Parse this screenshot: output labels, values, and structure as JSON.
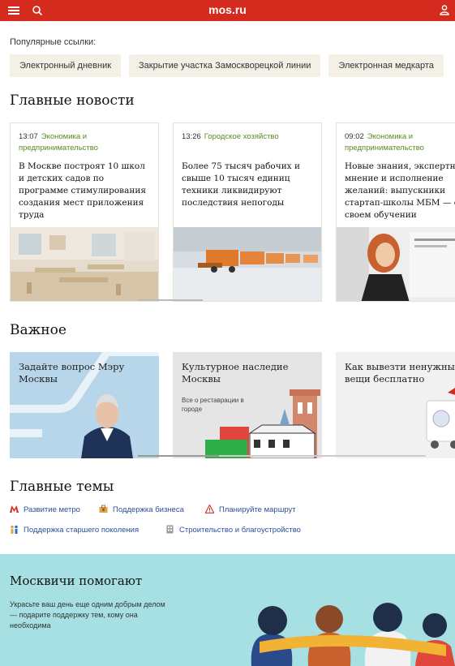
{
  "header": {
    "brand": "mos.ru"
  },
  "popular": {
    "label": "Популярные ссылки:",
    "chips": [
      "Электронный дневник",
      "Закрытие участка Замоскворецкой линии",
      "Электронная медкарта"
    ]
  },
  "news": {
    "heading": "Главные новости",
    "cards": [
      {
        "time": "13:07",
        "category": "Экономика и предпринимательство",
        "title": "В Москве построят 10 школ и детских садов по программе стимулирования создания мест приложения труда"
      },
      {
        "time": "13:26",
        "category": "Городское хозяйство",
        "title": "Более 75 тысяч рабочих и свыше 10 тысяч единиц техники ликвидируют последствия непогоды"
      },
      {
        "time": "09:02",
        "category": "Экономика и предпринимательство",
        "title": "Новые знания, экспертное мнение и исполнение желаний: выпускники стартап-школы МБМ — о своем обучении"
      }
    ]
  },
  "important": {
    "heading": "Важное",
    "tiles": [
      {
        "title": "Задайте вопрос Мэру Москвы",
        "subtitle": ""
      },
      {
        "title": "Культурное наследие Москвы",
        "subtitle": "Все о реставрации в городе"
      },
      {
        "title": "Как вывезти ненужные вещи бесплатно",
        "subtitle": ""
      }
    ]
  },
  "themes": {
    "heading": "Главные темы",
    "items": [
      {
        "label": "Развитие метро",
        "icon": "metro-icon"
      },
      {
        "label": "Поддержка бизнеса",
        "icon": "business-icon"
      },
      {
        "label": "Планируйте маршрут",
        "icon": "warning-icon"
      },
      {
        "label": "Поддержка старшего поколения",
        "icon": "family-icon"
      },
      {
        "label": "Строительство и благоустройство",
        "icon": "building-icon"
      }
    ]
  },
  "helpers": {
    "heading": "Москвичи помогают",
    "description": "Украсьте ваш день еще одним добрым делом — подарите поддержку тем, кому она необходима"
  },
  "colors": {
    "brand": "#d52b1e",
    "category": "#5b8a1e",
    "link": "#2b4f9e",
    "banner": "#a6e0e2"
  }
}
